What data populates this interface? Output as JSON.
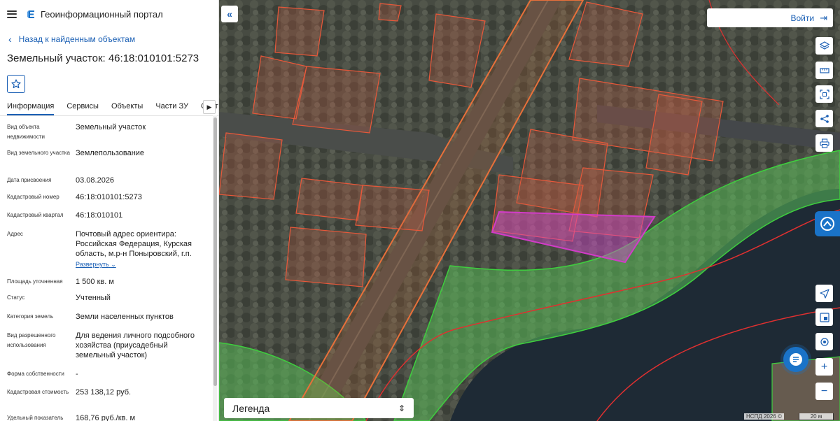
{
  "header": {
    "title": "Геоинформационный портал"
  },
  "nav": {
    "back_label": "Назад к найденным объектам"
  },
  "object": {
    "title": "Земельный участок: 46:18:010101:5273"
  },
  "tabs": [
    {
      "label": "Информация"
    },
    {
      "label": "Сервисы"
    },
    {
      "label": "Объекты"
    },
    {
      "label": "Части ЗУ"
    },
    {
      "label": "Состав"
    }
  ],
  "properties": [
    {
      "label": "Вид объекта недвижимости",
      "value": "Земельный участок"
    },
    {
      "label": "Вид земельного участка",
      "value": "Землепользование"
    },
    {
      "label": "Дата присвоения",
      "value": "03.08.2026"
    },
    {
      "label": "Кадастровый номер",
      "value": "46:18:010101:5273"
    },
    {
      "label": "Кадастровый квартал",
      "value": "46:18:010101"
    },
    {
      "label": "Адрес",
      "value": "Почтовый адрес ориентира: Российская Федерация, Курская область, м.р-н Поныровский, г.п.",
      "expand": "Развернуть"
    },
    {
      "label": "Площадь уточненная",
      "value": "1 500 кв. м"
    },
    {
      "label": "Статус",
      "value": "Учтенный"
    },
    {
      "label": "Категория земель",
      "value": "Земли населенных пунктов"
    },
    {
      "label": "Вид разрешенного использования",
      "value": "Для ведения личного подсобного хозяйства (приусадебный земельный участок)"
    },
    {
      "label": "Форма собственности",
      "value": "-"
    },
    {
      "label": "Кадастровая стоимость",
      "value": "253 138,12 руб."
    },
    {
      "label": "Удельный показатель",
      "value": "168,76 руб./кв. м"
    }
  ],
  "map": {
    "login_label": "Войти",
    "legend_label": "Легенда",
    "copyright": "НСПД 2026 ©",
    "scale": "20 м",
    "tools": [
      "layers-icon",
      "ruler-icon",
      "select-area-icon",
      "share-icon",
      "print-icon",
      "locate-icon",
      "minimap-icon",
      "geolocation-icon",
      "zoom-in-icon",
      "zoom-out-icon"
    ]
  },
  "colors": {
    "accent": "#1a5fb4",
    "selected_parcel": "#d23cc8",
    "parcel_border": "#e8583a",
    "zone_border": "#3ecf3e",
    "boundary": "#e03030"
  }
}
